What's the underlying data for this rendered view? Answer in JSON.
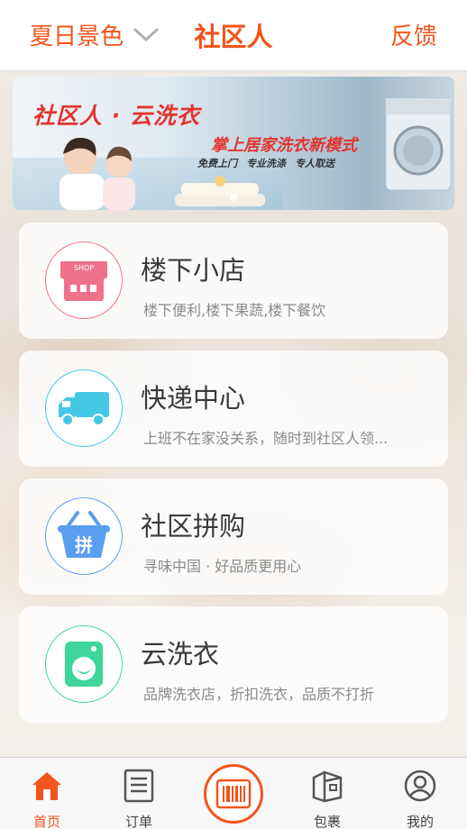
{
  "header": {
    "city": "夏日景色",
    "title": "社区人",
    "feedback": "反馈"
  },
  "banner": {
    "brand": "社区人 · 云洗衣",
    "slogan": "掌上居家洗衣新模式",
    "tags": [
      "免费上门",
      "专业洗涤",
      "专人取送"
    ]
  },
  "services": [
    {
      "title": "楼下小店",
      "desc": "楼下便利,楼下果蔬,楼下餐饮",
      "icon": "shop-icon",
      "shop_label": "SHOP",
      "color": "#f0728a"
    },
    {
      "title": "快递中心",
      "desc": "上班不在家没关系，随时到社区人领...",
      "icon": "truck-icon",
      "color": "#45c7e6"
    },
    {
      "title": "社区拼购",
      "desc": "寻味中国 · 好品质更用心",
      "icon": "basket-icon",
      "basket_label": "拼",
      "color": "#5a9ef0"
    },
    {
      "title": "云洗衣",
      "desc": "品牌洗衣店，折扣洗衣，品质不打折",
      "icon": "washer-icon",
      "color": "#3ed69a"
    }
  ],
  "tabbar": {
    "home": "首页",
    "orders": "订单",
    "scan_icon": "barcode-scan-icon",
    "parcels": "包裹",
    "mine": "我的"
  },
  "colors": {
    "accent": "#f2541c"
  }
}
